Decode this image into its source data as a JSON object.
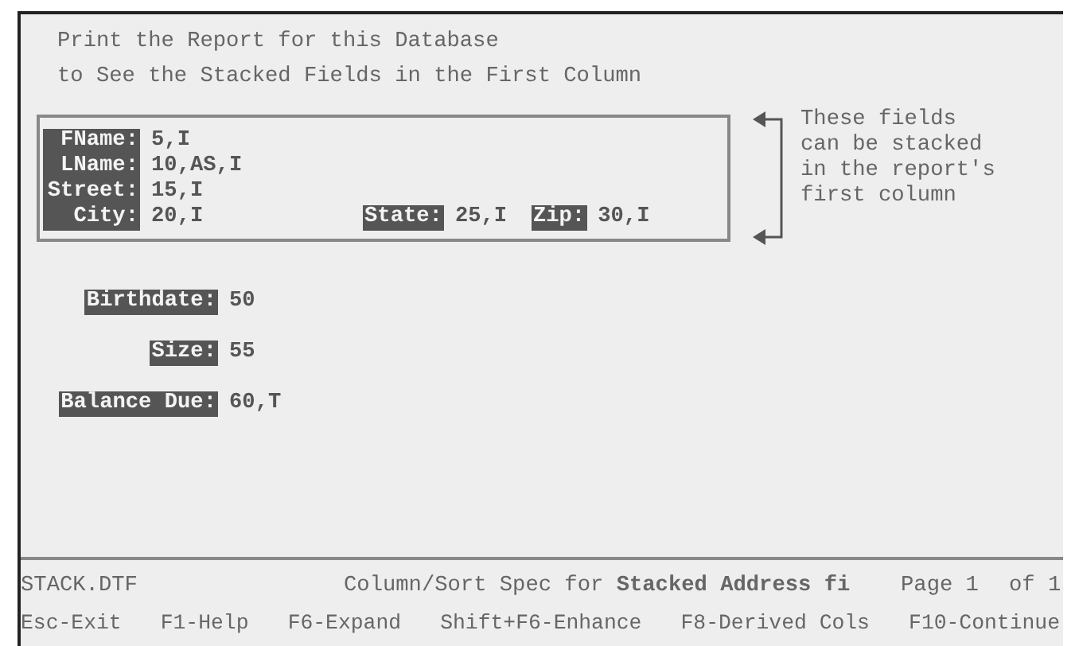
{
  "heading": [
    "Print the Report for this Database",
    "to See the Stacked Fields in the First Column"
  ],
  "stacked_rows": [
    {
      "fields": [
        {
          "label": "FName:",
          "value": "5,I"
        }
      ]
    },
    {
      "fields": [
        {
          "label": "LName:",
          "value": "10,AS,I"
        }
      ]
    },
    {
      "fields": [
        {
          "label": "Street:",
          "value": "15,I"
        }
      ]
    },
    {
      "fields": [
        {
          "label": "City:",
          "value": "20,I"
        },
        {
          "label": "State:",
          "value": "25,I"
        },
        {
          "label": "Zip:",
          "value": "30,I"
        }
      ]
    }
  ],
  "note": "These fields\ncan be stacked\nin the report's\nfirst column",
  "other_fields": [
    {
      "label": "Birthdate:",
      "value": "50"
    },
    {
      "label": "Size:",
      "value": "55"
    },
    {
      "label": "Balance Due:",
      "value": "60,T"
    }
  ],
  "status_bar": {
    "file": "STACK.DTF",
    "spec": "Column/Sort Spec for **Stacked Address fi**",
    "page": "Page 1",
    "page_count": "of 1"
  },
  "function_keys": [
    "Esc-Exit",
    "F1-Help",
    "F6-Expand",
    "Shift+F6-Enhance",
    "F8-Derived Cols",
    "F10-Continue"
  ]
}
